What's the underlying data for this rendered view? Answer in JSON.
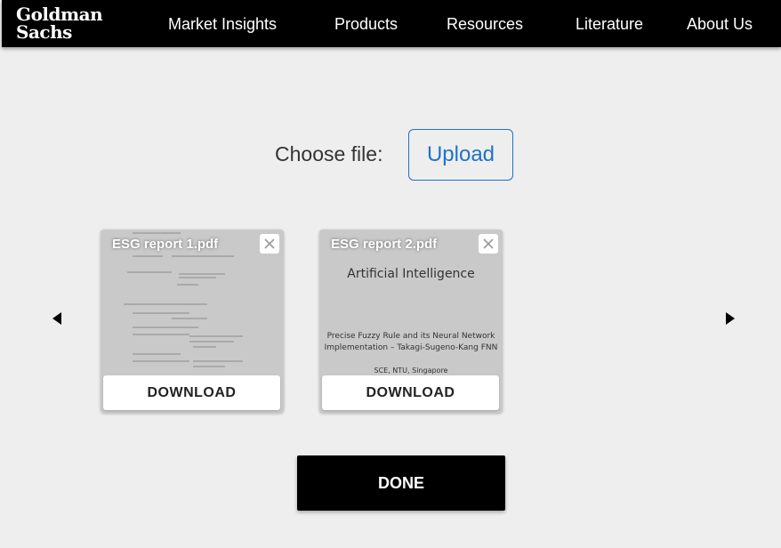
{
  "header": {
    "logo_line1": "Goldman",
    "logo_line2": "Sachs",
    "nav": [
      "Market Insights",
      "Products",
      "Resources",
      "Literature",
      "About Us"
    ]
  },
  "upload": {
    "label": "Choose file:",
    "button_label": "Upload"
  },
  "files": [
    {
      "name": "ESG report 1.pdf",
      "download_label": "DOWNLOAD"
    },
    {
      "name": "ESG report 2.pdf",
      "download_label": "DOWNLOAD",
      "preview_title": "Artificial Intelligence",
      "preview_subtitle_1": "Precise Fuzzy Rule and its Neural Network",
      "preview_subtitle_2": "Implementation – Takagi-Sugeno-Kang FNN",
      "preview_footer": "SCE, NTU, Singapore"
    }
  ],
  "done_label": "DONE",
  "colors": {
    "accent": "#1e72c8",
    "header_bg": "#000000",
    "page_bg": "#eeeeee"
  },
  "icons": {
    "close": "close-icon",
    "prev": "chevron-left-icon",
    "next": "chevron-right-icon"
  }
}
